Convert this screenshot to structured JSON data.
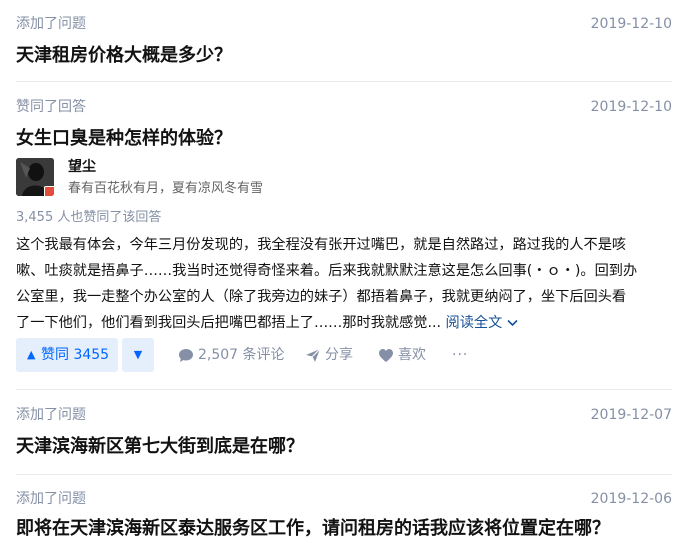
{
  "items": [
    {
      "action": "添加了问题",
      "date": "2019-12-10",
      "title": "天津租房价格大概是多少？"
    },
    {
      "action": "赞同了回答",
      "date": "2019-12-10",
      "title": "女生口臭是种怎样的体验？",
      "author": {
        "name": "望尘",
        "bio": "春有百花秋有月，夏有凉风冬有雪"
      },
      "voters_text": "3,455 人也赞同了该回答",
      "excerpt_lines": [
        "这个我最有体会，今年三月份发现的，我全程没有张开过嘴巴，就是自然路过，路过我的人不是咳",
        "嗽、吐痰就是捂鼻子……我当时还觉得奇怪来着。后来我就默默注意这是怎么回事(・ｏ・)。回到办",
        "公室里，我一走整个办公室的人（除了我旁边的妹子）都捂着鼻子，我就更纳闷了，坐下后回头看",
        "了一下他们，他们看到我回头后把嘴巴都捂上了……那时我就感觉..."
      ],
      "read_more": "阅读全文",
      "actions": {
        "vote": "赞同 3455",
        "comments": "2,507 条评论",
        "share": "分享",
        "like": "喜欢",
        "more": "···"
      }
    },
    {
      "action": "添加了问题",
      "date": "2019-12-07",
      "title": "天津滨海新区第七大街到底是在哪？"
    },
    {
      "action": "添加了问题",
      "date": "2019-12-06",
      "title": "即将在天津滨海新区泰达服务区工作，请问租房的话我应该将位置定在哪？"
    }
  ],
  "colors": {
    "meta": "#8590a6",
    "title": "#121212",
    "accent": "#0066ff",
    "vote_bg": "#e5eefb",
    "link": "#175199"
  }
}
